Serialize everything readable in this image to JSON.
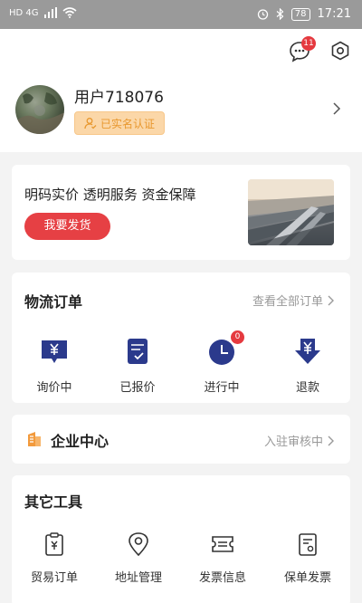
{
  "status_bar": {
    "carrier": "HD 4G",
    "battery": "78",
    "time": "17:21"
  },
  "header": {
    "message_badge_count": "11",
    "username": "用户718076",
    "verify_label": "已实名认证"
  },
  "banner": {
    "slogan": "明码实价 透明服务 资金保障",
    "cta_label": "我要发货"
  },
  "logistics": {
    "title": "物流订单",
    "view_all_label": "查看全部订单",
    "items": [
      {
        "label": "询价中",
        "icon": "yen-message-icon"
      },
      {
        "label": "已报价",
        "icon": "quote-doc-icon"
      },
      {
        "label": "进行中",
        "icon": "clock-icon",
        "badge": "0"
      },
      {
        "label": "退款",
        "icon": "yen-down-arrow-icon"
      }
    ]
  },
  "enterprise": {
    "title": "企业中心",
    "status": "入驻审核中"
  },
  "tools": {
    "title": "其它工具",
    "items": [
      {
        "label": "贸易订单",
        "icon": "trade-clipboard-icon"
      },
      {
        "label": "地址管理",
        "icon": "location-pin-icon"
      },
      {
        "label": "发票信息",
        "icon": "ticket-icon"
      },
      {
        "label": "保单发票",
        "icon": "policy-doc-icon"
      }
    ]
  },
  "colors": {
    "accent_red": "#e64044",
    "icon_navy": "#2b3a8c",
    "verify_bg": "#fbd7a8",
    "verify_text": "#e8982f",
    "enterprise_icon": "#f29a3c"
  }
}
